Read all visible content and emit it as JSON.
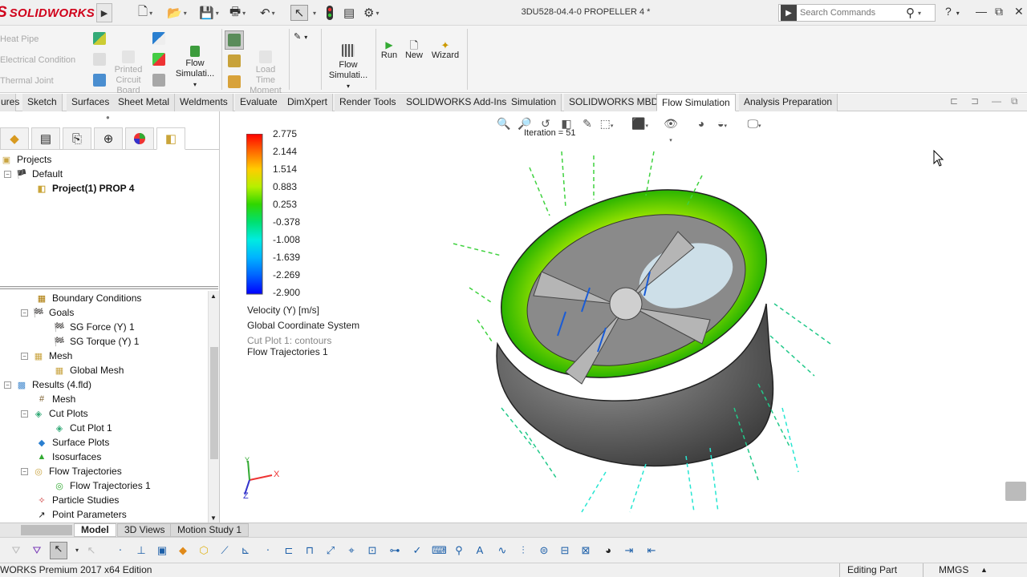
{
  "app": {
    "brand_ds": "S",
    "brand_name": "SOLIDWORKS",
    "document_title": "3DU528-04.4-0 PROPELLER 4 *"
  },
  "search": {
    "placeholder": "Search Commands"
  },
  "command_manager": {
    "grey_labels": [
      "Heat Pipe",
      "Electrical Condition",
      "Thermal Joint"
    ],
    "buttons": {
      "printed_circuit_board": "Printed\nCircuit\nBoard",
      "flow_simulation_1": "Flow\nSimulati...",
      "load_time_moment": "Load\nTime\nMoment",
      "flow_simulation_2": "Flow\nSimulati...",
      "run": "Run",
      "new": "New",
      "wizard": "Wizard"
    }
  },
  "tabs": [
    {
      "label": "ures"
    },
    {
      "label": "Sketch"
    },
    {
      "label": "Surfaces"
    },
    {
      "label": "Sheet Metal"
    },
    {
      "label": "Weldments"
    },
    {
      "label": "Evaluate"
    },
    {
      "label": "DimXpert"
    },
    {
      "label": "Render Tools"
    },
    {
      "label": "SOLIDWORKS Add-Ins"
    },
    {
      "label": "Simulation"
    },
    {
      "label": "SOLIDWORKS MBD"
    },
    {
      "label": "Flow Simulation"
    },
    {
      "label": "Analysis Preparation"
    }
  ],
  "projects_tree": {
    "root": "Projects",
    "default": "Default",
    "project": "Project(1) PROP 4"
  },
  "analysis_tree": [
    {
      "label": "Boundary Conditions",
      "depth": 2
    },
    {
      "label": "Goals",
      "depth": 2
    },
    {
      "label": "SG Force (Y) 1",
      "depth": 3
    },
    {
      "label": "SG Torque (Y) 1",
      "depth": 3
    },
    {
      "label": "Mesh",
      "depth": 2
    },
    {
      "label": "Global Mesh",
      "depth": 3
    },
    {
      "label": "Results (4.fld)",
      "depth": 1
    },
    {
      "label": "Mesh",
      "depth": 2
    },
    {
      "label": "Cut Plots",
      "depth": 2
    },
    {
      "label": "Cut Plot 1",
      "depth": 3
    },
    {
      "label": "Surface Plots",
      "depth": 2
    },
    {
      "label": "Isosurfaces",
      "depth": 2
    },
    {
      "label": "Flow Trajectories",
      "depth": 2
    },
    {
      "label": "Flow Trajectories 1",
      "depth": 3
    },
    {
      "label": "Particle Studies",
      "depth": 2
    },
    {
      "label": "Point Parameters",
      "depth": 2
    }
  ],
  "viewport": {
    "iteration": "Iteration = 51",
    "legend_values": [
      "2.775",
      "2.144",
      "1.514",
      "0.883",
      "0.253",
      "-0.378",
      "-1.008",
      "-1.639",
      "-2.269",
      "-2.900"
    ],
    "legend_title": "Velocity (Y) [m/s]",
    "coord_system": "Global Coordinate System",
    "cut_plot": "Cut Plot 1: contours",
    "flow_traj": "Flow Trajectories 1",
    "triad": {
      "x": "X",
      "y": "Y",
      "z": "Z"
    }
  },
  "bottom_tabs": [
    {
      "label": "Model"
    },
    {
      "label": "3D Views"
    },
    {
      "label": "Motion Study 1"
    }
  ],
  "status": {
    "edition": "WORKS Premium 2017 x64 Edition",
    "mode": "Editing Part",
    "units": "MMGS"
  },
  "colors": {
    "accent": "#d0021b",
    "legend_top": "#ff0000",
    "legend_bottom": "#0000ff"
  }
}
